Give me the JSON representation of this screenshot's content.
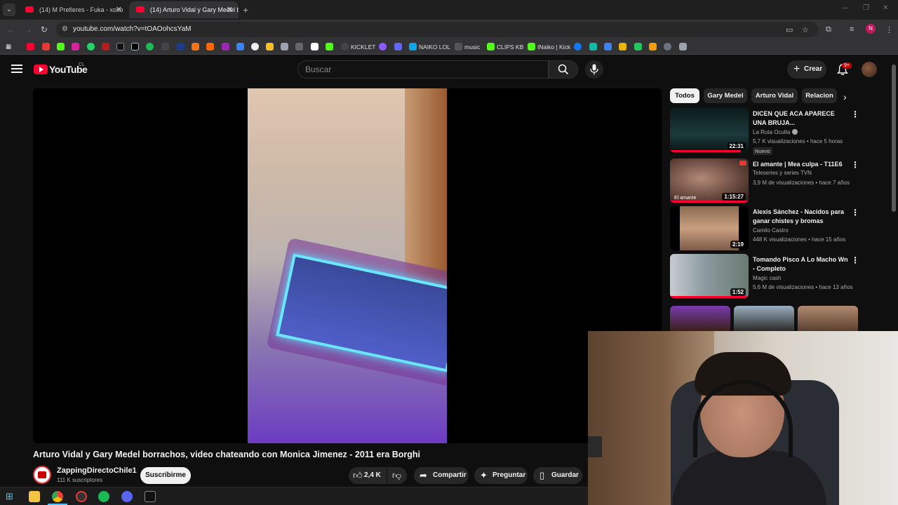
{
  "browser": {
    "tabs": [
      {
        "title": "(14) M Prefieres - Fuka - xoxo",
        "active": false
      },
      {
        "title": "(14) Arturo Vidal y Gary Medel b",
        "active": true
      }
    ],
    "url": "youtube.com/watch?v=tOAOohcsYaM",
    "bookmarks": [
      "KICKLET",
      "NAIKO LOL",
      "music",
      "CLIPS KB",
      "INaiko | Kick"
    ],
    "profile_initial": "N"
  },
  "youtube": {
    "logo_text": "YouTube",
    "region": "CL",
    "search_placeholder": "Buscar",
    "create_label": "Crear",
    "notif_count": "9+"
  },
  "video": {
    "title": "Arturo Vidal y Gary Medel borrachos, video chateando con Monica Jimenez - 2011 era Borghi",
    "channel": "ZappingDirectoChile1",
    "subscribers": "111 K suscriptores",
    "subscribe_label": "Suscribirme",
    "likes": "2,4 K",
    "share_label": "Compartir",
    "ask_label": "Preguntar",
    "save_label": "Guardar"
  },
  "chips": [
    "Todos",
    "Gary Medel",
    "Arturo Vidal",
    "Relacion"
  ],
  "recommendations": [
    {
      "title": "DICEN QUE ACA APARECE UNA BRUJA...",
      "channel": "La Ruta Oculta",
      "meta": "5,7 K visualizaciones • hace 5 horas",
      "duration": "22:31",
      "badge": "Nuevo",
      "verified": true,
      "progress": 0.9
    },
    {
      "title": "El amante | Mea culpa - T11E6",
      "channel": "Teleseries y series TVN",
      "meta": "3,9 M de visualizaciones • hace 7 años",
      "duration": "1:15:27",
      "progress": 1.0,
      "thumb_label": "El amante"
    },
    {
      "title": "Alexis Sánchez - Nacidos para ganar chistes y bromas",
      "channel": "Camilo Castro",
      "meta": "448 K visualizaciones • hace 15 años",
      "duration": "2:19",
      "progress": 0
    },
    {
      "title": "Tomando Pisco A Lo Macho Wn - Completo",
      "channel": "Magic cash",
      "meta": "5,6 M de visualizaciones • hace 13 años",
      "duration": "1:52",
      "progress": 1.0
    }
  ],
  "colors": {
    "accent": "#ff0033",
    "bg": "#0f0f0f",
    "chip_bg": "#272727"
  }
}
